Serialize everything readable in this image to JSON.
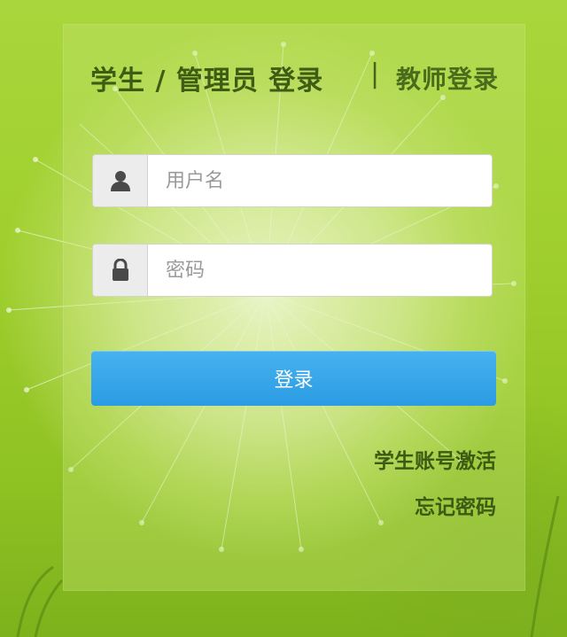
{
  "tabs": {
    "student_admin": "学生 / 管理员 登录",
    "separator": "|",
    "teacher": "教师登录"
  },
  "form": {
    "username_placeholder": "用户名",
    "password_placeholder": "密码",
    "login_label": "登录"
  },
  "links": {
    "activate_account": "学生账号激活",
    "forgot_password": "忘记密码"
  },
  "icons": {
    "username": "user-icon",
    "password": "lock-icon"
  },
  "colors": {
    "button": "#2b9ce4",
    "heading_text": "#3e5c14",
    "background_green": "#9fcf2e"
  }
}
